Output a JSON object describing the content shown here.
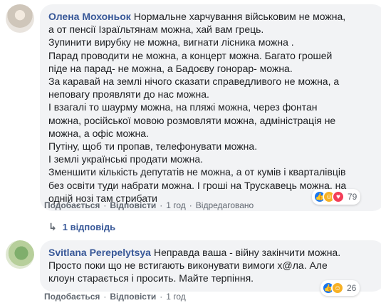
{
  "comments": [
    {
      "author": "Олена Мохоньок",
      "text_lines": [
        "Нормальне харчування військовим не можна,",
        "а от пенсії Ізраїльтянам можна, хай вам грець.",
        "Зупинити вирубку не можна, вигнати лісника можна .",
        "Парад проводити не можна, а концерт можна. Багато грошей",
        "піде на парад- не можна, а Бадоєву гонорар- можна.",
        "За каравай на землі нічого сказати справедливого не можна, а",
        "неповагу проявляти до нас можна.",
        "І взагалі то шаурму можна, на пляжі можна, через фонтан",
        "можна, російської мовою розмовляти можна, адміністрація не",
        "можна, а офіс можна.",
        "Путіну, щоб ти пропав, телефонувати можна.",
        "І землі українські продати можна.",
        "Зменшити кількість депутатів не можна, а от кумів і кварталівців",
        "без освіти туди набрати можна. І гроші на Трускавець можна, на",
        "одній нозі там стрибати"
      ],
      "reaction_count": "79",
      "actions": {
        "like": "Подобається",
        "reply": "Відповісти",
        "time": "1 год",
        "edited": "Відредаговано"
      },
      "replies_link": "1 відповідь"
    },
    {
      "author": "Svitlana Perepelytsya",
      "text_lines": [
        "Неправда ваша - війну закінчити можна.",
        "Просто поки що не встигають виконувати вимоги х@ла. Але",
        "клоун старається і просить. Майте терпіння."
      ],
      "reaction_count": "26",
      "actions": {
        "like": "Подобається",
        "reply": "Відповісти",
        "time": "1 год"
      }
    }
  ],
  "separator": "·",
  "icons": {
    "like": "like-icon",
    "haha": "haha-icon",
    "love": "love-icon",
    "reply_arrow": "reply-arrow-icon"
  },
  "colors": {
    "author": "#385898",
    "bubble": "#f2f3f5",
    "like": "#1877f2",
    "haha": "#f7b125",
    "love": "#f33e58"
  }
}
